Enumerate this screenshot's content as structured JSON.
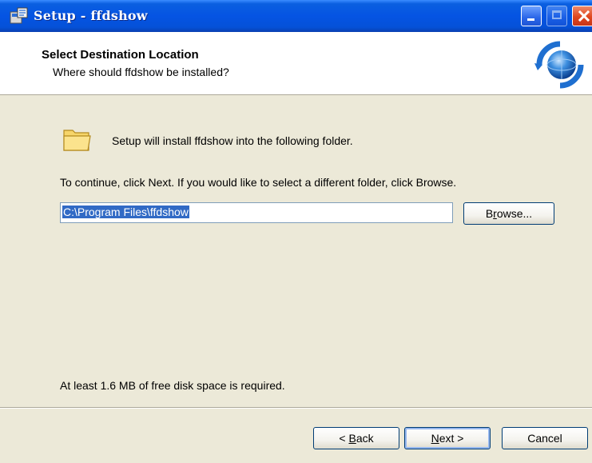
{
  "window": {
    "title": "Setup - ffdshow",
    "icon": "setup-app-icon"
  },
  "header": {
    "title": "Select Destination Location",
    "subtitle": "Where should ffdshow be installed?",
    "graphic": "globe-install-icon"
  },
  "body": {
    "info_text": "Setup will install ffdshow into the following folder.",
    "instruction_text": "To continue, click Next. If you would like to select a different folder, click Browse.",
    "install_path": "C:\\Program Files\\ffdshow",
    "browse_label_pre": "B",
    "browse_label_acc": "r",
    "browse_label_post": "owse...",
    "disk_space_text": "At least 1.6 MB of free disk space is required."
  },
  "footer": {
    "back_pre": "< ",
    "back_acc": "B",
    "back_post": "ack",
    "next_acc": "N",
    "next_post": "ext >",
    "cancel_label": "Cancel"
  },
  "colors": {
    "titlebar": "#0554E3",
    "dialog_bg": "#ECE9D8",
    "selection": "#316AC5"
  }
}
